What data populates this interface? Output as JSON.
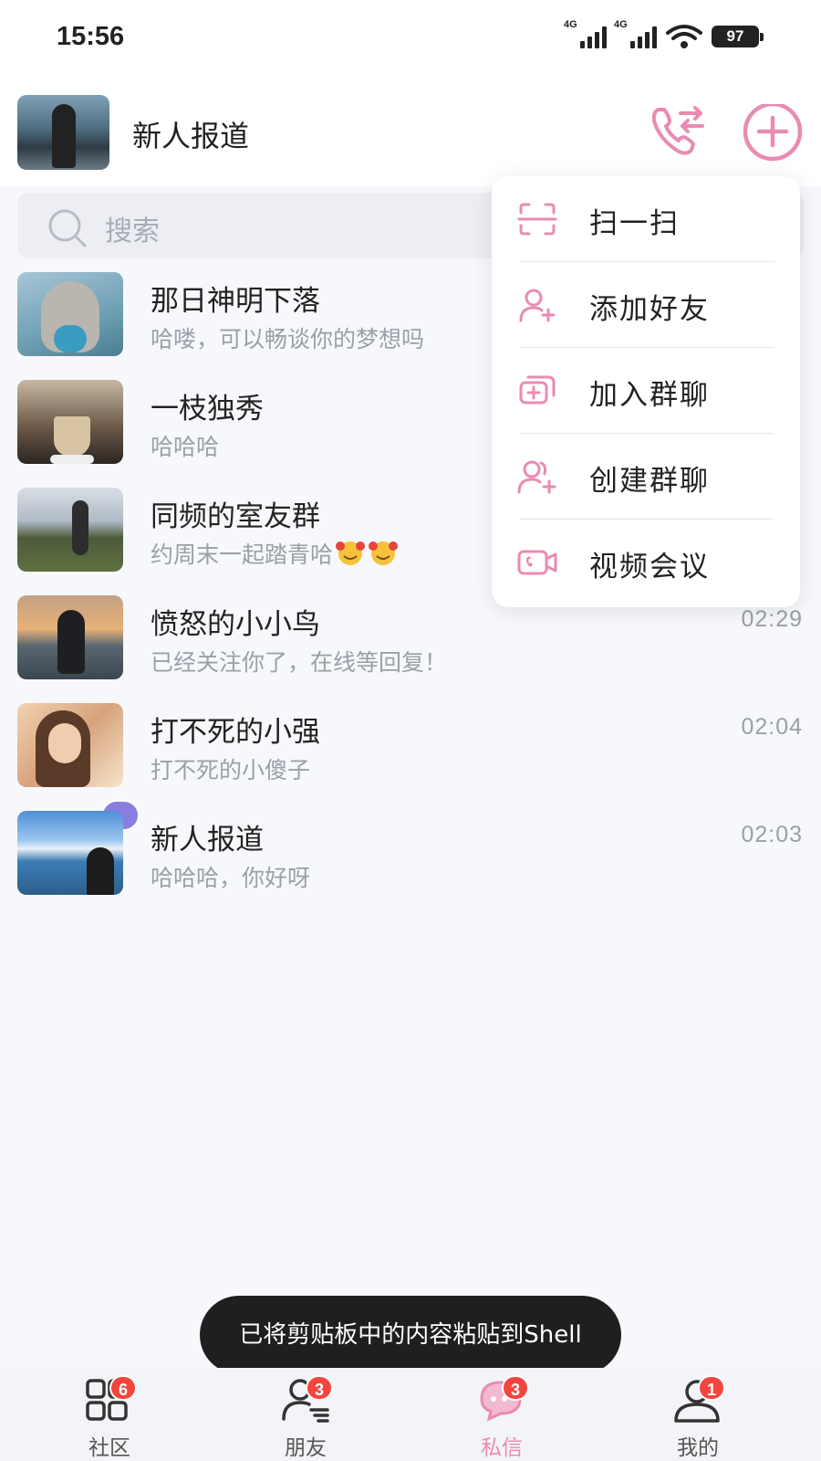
{
  "status_bar": {
    "time": "15:56",
    "network_1": "4G",
    "network_2": "4G",
    "battery": "97"
  },
  "header": {
    "title": "新人报道",
    "call_icon": "phone-switch-icon",
    "add_icon": "plus-circle-icon"
  },
  "search": {
    "placeholder": "搜索"
  },
  "chats": [
    {
      "name": "那日神明下落",
      "preview": "哈喽，可以畅谈你的梦想吗",
      "time": ""
    },
    {
      "name": "一枝独秀",
      "preview": "哈哈哈",
      "time": ""
    },
    {
      "name": "同频的室友群",
      "preview": "约周末一起踏青哈",
      "time": ""
    },
    {
      "name": "愤怒的小小鸟",
      "preview": "已经关注你了，在线等回复！",
      "time": "02:29"
    },
    {
      "name": "打不死的小强",
      "preview": "打不死的小傻子",
      "time": "02:04"
    },
    {
      "name": "新人报道",
      "preview": "哈哈哈，你好呀",
      "time": "02:03"
    }
  ],
  "menu": {
    "items": [
      {
        "label": "扫一扫",
        "icon": "scan-icon"
      },
      {
        "label": "添加好友",
        "icon": "add-friend-icon"
      },
      {
        "label": "加入群聊",
        "icon": "join-group-icon"
      },
      {
        "label": "创建群聊",
        "icon": "create-group-icon"
      },
      {
        "label": "视频会议",
        "icon": "video-meeting-icon"
      }
    ]
  },
  "toast": {
    "text": "已将剪贴板中的内容粘贴到Shell"
  },
  "tabs": [
    {
      "label": "社区",
      "badge": "6",
      "icon": "community-grid-icon"
    },
    {
      "label": "朋友",
      "badge": "3",
      "icon": "friends-icon"
    },
    {
      "label": "私信",
      "badge": "3",
      "icon": "message-icon",
      "active": true
    },
    {
      "label": "我的",
      "badge": "1",
      "icon": "profile-icon"
    }
  ],
  "colors": {
    "accent": "#e98bb3",
    "badge": "#f3453e",
    "toast_bg": "#1f1f1f"
  }
}
